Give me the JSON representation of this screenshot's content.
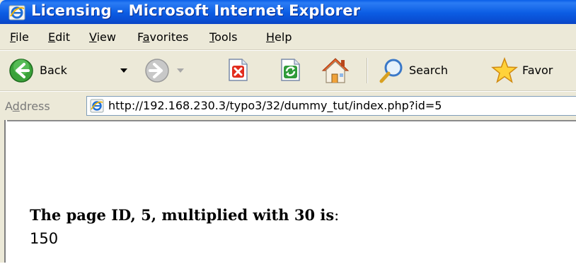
{
  "window": {
    "title": "Licensing - Microsoft Internet Explorer"
  },
  "menubar": {
    "items": [
      {
        "label": "File",
        "accel": "F",
        "rest": "ile"
      },
      {
        "label": "Edit",
        "accel": "E",
        "rest": "dit"
      },
      {
        "label": "View",
        "accel": "V",
        "rest": "iew"
      },
      {
        "label": "Favorites",
        "pre": "F",
        "accel": "a",
        "rest": "vorites"
      },
      {
        "label": "Tools",
        "accel": "T",
        "rest": "ools"
      },
      {
        "label": "Help",
        "accel": "H",
        "rest": "elp"
      }
    ]
  },
  "toolbar": {
    "back_label": "Back",
    "search_label": "Search",
    "favorites_label": "Favor"
  },
  "address": {
    "label": "Address",
    "label_pre": "A",
    "label_accel": "d",
    "label_rest": "dress",
    "url": "http://192.168.230.3/typo3/32/dummy_tut/index.php?id=5"
  },
  "content": {
    "heading_bold": "The page ID, 5, multiplied with 30 is",
    "heading_tail": ":",
    "result": "150"
  },
  "colors": {
    "titlebar": "#0b5ce3",
    "chrome": "#ece9d8",
    "back_green": "#3aa23a"
  }
}
